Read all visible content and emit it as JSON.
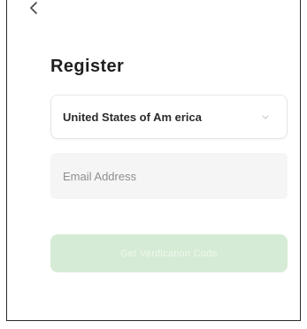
{
  "header": {
    "back_icon": "chevron-left-icon",
    "title": "Register"
  },
  "form": {
    "country": {
      "value": "United States of Am erica",
      "icon": "chevron-down-icon"
    },
    "email": {
      "placeholder": "Email Address",
      "value": ""
    },
    "verify_button_label": "Get Verification Code"
  },
  "colors": {
    "button_disabled_bg": "#d6ebd5",
    "input_bg": "#f5f5f5",
    "title_text": "#1f1f1f"
  }
}
